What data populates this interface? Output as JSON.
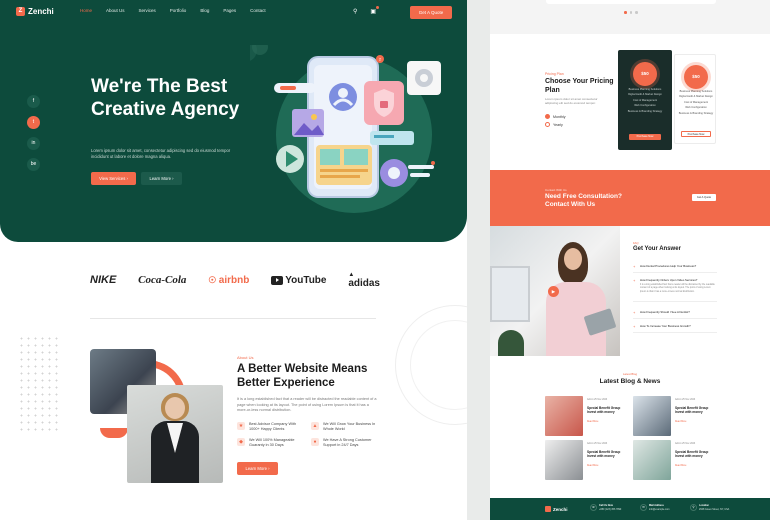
{
  "brand": {
    "name": "Zenchi",
    "logo_letter": "Z"
  },
  "nav": {
    "items": [
      "Home",
      "About Us",
      "Services",
      "Portfolio",
      "Blog",
      "Pages",
      "Contact"
    ],
    "search_icon": "search-icon",
    "cart_icon": "cart-icon",
    "quote_label": "Get A Quote"
  },
  "social": [
    "f",
    "t",
    "in",
    "be"
  ],
  "hero": {
    "title": "We're The Best Creative Agency",
    "description": "Lorem ipsum dolor sit amet, consectetur adipiscing sed do eiusmod tempor incididunt ut labore et dolore magna aliqua.",
    "primary_label": "View Services",
    "secondary_label": "Learn More"
  },
  "brands": {
    "nike": "NIKE",
    "coke": "Coca-Cola",
    "airbnb": "airbnb",
    "youtube": "YouTube",
    "adidas": "adidas"
  },
  "about": {
    "tag": "About Us",
    "title": "A Better Website Means Better Experience",
    "description": "It is a long established fact that a reader will be distracted the readable content of a page when looking at its layout. The point of using Lorem Ipsum is that it has a more-or-less normal distribution.",
    "features": [
      {
        "text": "Best Advisor Company With 1000+ Happy Clients",
        "icon": "trophy-icon"
      },
      {
        "text": "We Will Grow Your Business In Whole World",
        "icon": "chart-icon"
      },
      {
        "text": "We Will 100% Manageable Guaranty in 30 Days",
        "icon": "shield-icon"
      },
      {
        "text": "We Have A Strong Customer Support in 24/7 Days",
        "icon": "headset-icon"
      }
    ],
    "button_label": "Learn More"
  },
  "pricing": {
    "tag": "Pricing Plan",
    "title": "Choose Your Pricing Plan",
    "description": "Lorem ipsum dolor sit amet consectetur adipiscing elit sed do eiusmod tempor.",
    "options": [
      "Monthly",
      "Yearly"
    ],
    "plans": [
      {
        "price": "$50",
        "features": [
          "Business Planning Solutions",
          "Digital Audit & Market Design",
          "Cost of Management",
          "Web Configuration",
          "Business & Branding Strategy"
        ],
        "button": "Purchase Now"
      },
      {
        "price": "$50",
        "features": [
          "Business Planning Solutions",
          "Digital Audit & Market Design",
          "Cost of Management",
          "Web Configuration",
          "Business & Branding Strategy"
        ],
        "button": "Purchase Now"
      }
    ]
  },
  "consult": {
    "tag": "Contact With Us",
    "title": "Need Free Consultation? Contact With Us",
    "button": "Get A Quote"
  },
  "faq": {
    "tag": "FAQ",
    "title": "Get Your Answer",
    "items": [
      {
        "q": "How Dental Procedures Help Your Business?",
        "a": ""
      },
      {
        "q": "How Frequently Orders Upon Video Services?",
        "a": "It is a long established fact that a reader will be distracted by the readable content of a page when looking at its layout. The point of using Lorem Ipsum is that it has a more-or-less normal distribution."
      },
      {
        "q": "How Frequently Should I See A Dentist?",
        "a": ""
      },
      {
        "q": "How To Increase Your Business Growth?",
        "a": ""
      }
    ]
  },
  "blog": {
    "tag": "Latest Blog",
    "title": "Latest Blog & News",
    "posts": [
      {
        "meta": "Admin   25 Nov 2023",
        "title": "Special Benefit Group Invest with money",
        "more": "Read More"
      },
      {
        "meta": "Admin   25 Nov 2023",
        "title": "Special Benefit Group Invest with money",
        "more": "Read More"
      },
      {
        "meta": "Admin   25 Nov 2023",
        "title": "Special Benefit Group Invest with money",
        "more": "Read More"
      },
      {
        "meta": "Admin   25 Nov 2023",
        "title": "Special Benefit Group Invest with money",
        "more": "Read More"
      }
    ]
  },
  "footer": {
    "call_label": "Call Us Now",
    "call_value": "+880 (123) 456 7890",
    "mail_label": "Mail Address",
    "mail_value": "info@example.com",
    "loc_label": "Location",
    "loc_value": "2648 Green Street, NY, USA"
  },
  "colors": {
    "primary": "#0d4b3c",
    "accent": "#f26a4b"
  }
}
